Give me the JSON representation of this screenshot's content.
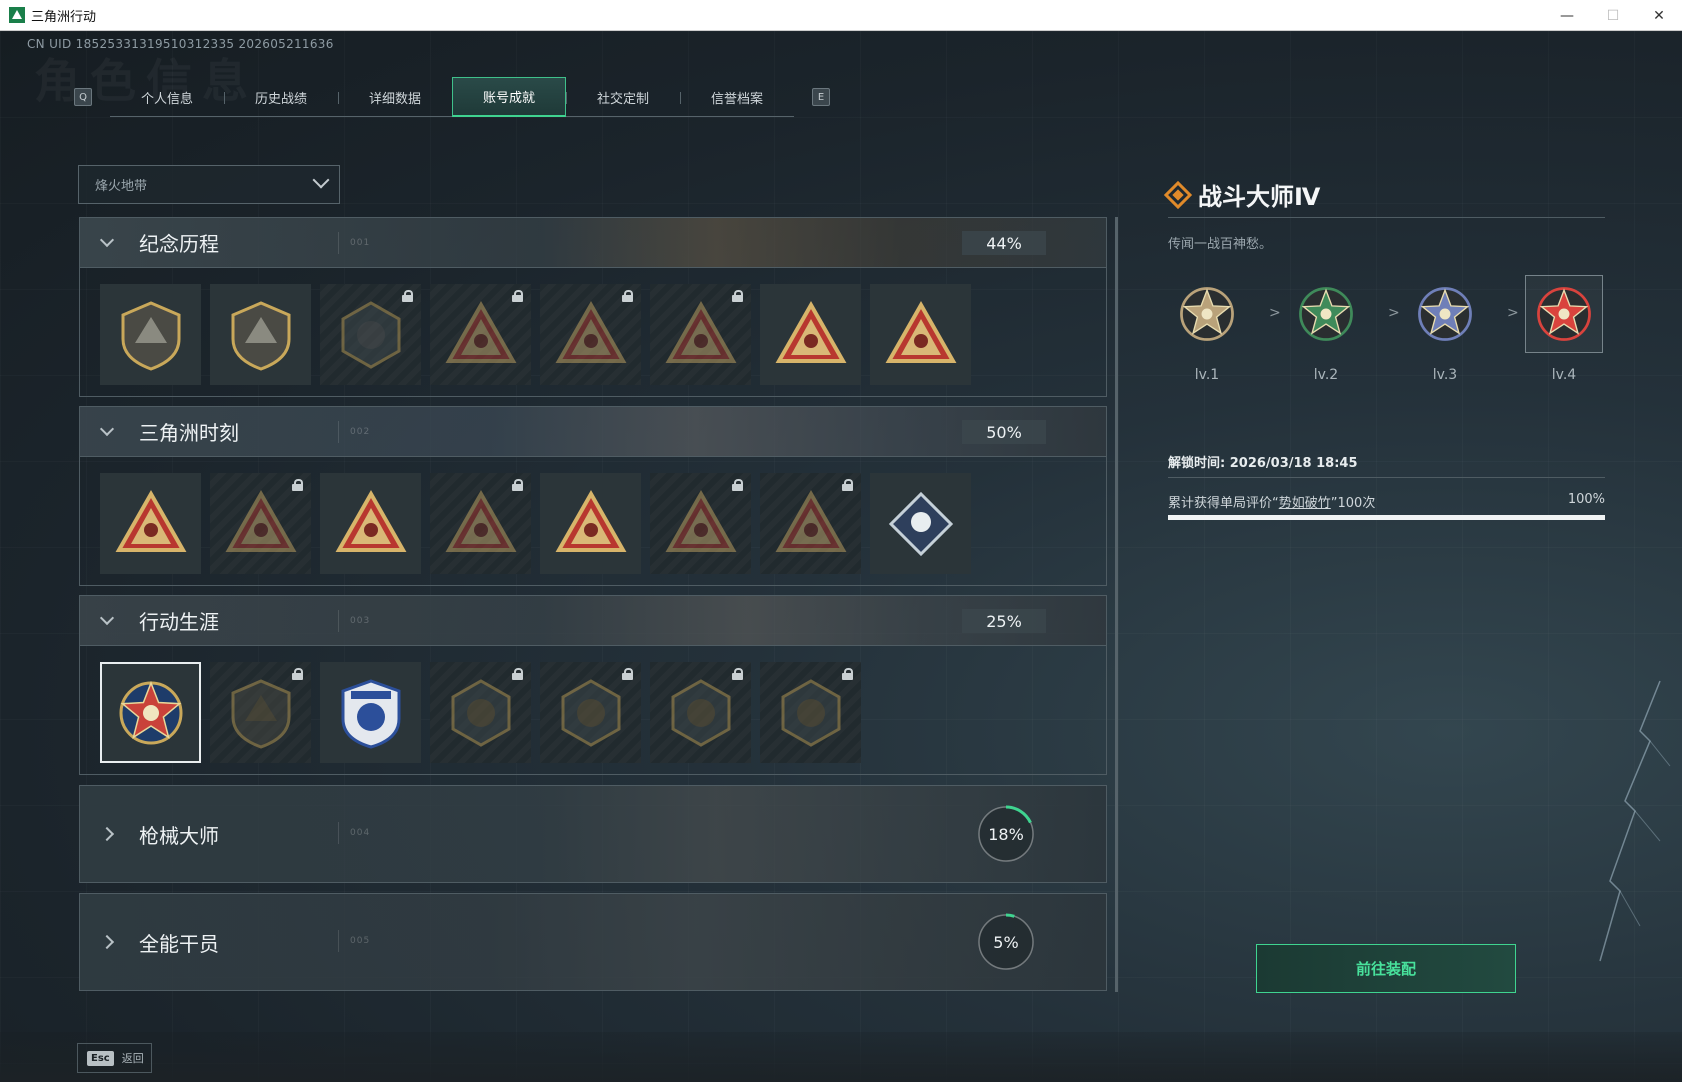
{
  "window": {
    "title": "三角洲行动",
    "minimize": "—",
    "maximize": "☐",
    "close": "✕"
  },
  "uid": "CN UID 18525331319510312335 202605211636",
  "bg_word": "角色信息",
  "tabs": {
    "prev_key": "Q",
    "next_key": "E",
    "items": [
      {
        "label": "个人信息"
      },
      {
        "label": "历史战绩"
      },
      {
        "label": "详细数据"
      },
      {
        "label": "账号成就",
        "active": true
      },
      {
        "label": "社交定制"
      },
      {
        "label": "信誉档案"
      }
    ]
  },
  "mode_dropdown": {
    "value": "烽火地带"
  },
  "categories": [
    {
      "name": "纪念历程",
      "dots": "001",
      "percent": "44%",
      "expanded": true,
      "badges": [
        "mountain-shield-icon",
        "helicopter-shield-icon",
        "hex-emblem-icon",
        "tank-triangle-icon",
        "hooded-triangle-icon",
        "skull-triangle-icon",
        "hands-triangle-icon",
        "number-one-triangle-icon"
      ],
      "locked": [
        false,
        false,
        true,
        true,
        true,
        true,
        false,
        false
      ]
    },
    {
      "name": "三角洲时刻",
      "dots": "002",
      "percent": "50%",
      "expanded": true,
      "badges": [
        "gear-triangle-icon",
        "soldier-triangle-icon",
        "crouch-triangle-icon",
        "diamond-triangle-icon",
        "fighters-triangle-icon",
        "dragon-triangle-icon",
        "fish-triangle-icon",
        "rose-diamond-icon"
      ],
      "locked": [
        false,
        true,
        false,
        true,
        false,
        true,
        true,
        false
      ]
    },
    {
      "name": "行动生涯",
      "dots": "003",
      "percent": "25%",
      "expanded": true,
      "badges": [
        "battle-master-star-icon",
        "wing-shield-icon",
        "police-shield-icon",
        "hex-gem-shield-icon",
        "disc-shield-icon",
        "skull-crosshair-icon",
        "eye-shield-icon"
      ],
      "locked": [
        false,
        true,
        false,
        true,
        true,
        true,
        true
      ]
    },
    {
      "name": "枪械大师",
      "dots": "004",
      "percent": "18%",
      "progress": 0.18,
      "expanded": false
    },
    {
      "name": "全能干员",
      "dots": "005",
      "percent": "5%",
      "progress": 0.05,
      "expanded": false
    }
  ],
  "detail": {
    "title": "战斗大师Ⅳ",
    "description": "传闻一战百神愁。",
    "levels": [
      {
        "label": "lv.1",
        "color": "#b9a27a"
      },
      {
        "label": "lv.2",
        "color": "#3f8a5a"
      },
      {
        "label": "lv.3",
        "color": "#6f7fb8"
      },
      {
        "label": "lv.4",
        "color": "#d9433d",
        "current": true
      }
    ],
    "level_arrow": ">",
    "unlock_time": "解锁时间: 2026/03/18 18:45",
    "requirement_prefix": "累计获得单局评价“",
    "requirement_link": "势如破竹",
    "requirement_suffix": "”100次",
    "requirement_percent": "100%",
    "requirement_progress": 1.0,
    "equip_label": "前往装配"
  },
  "footer": {
    "esc_key": "Esc",
    "back_label": "返回"
  },
  "colors": {
    "accent_green": "#3fd490",
    "gold": "#c9a85a",
    "red": "#b8372f"
  }
}
